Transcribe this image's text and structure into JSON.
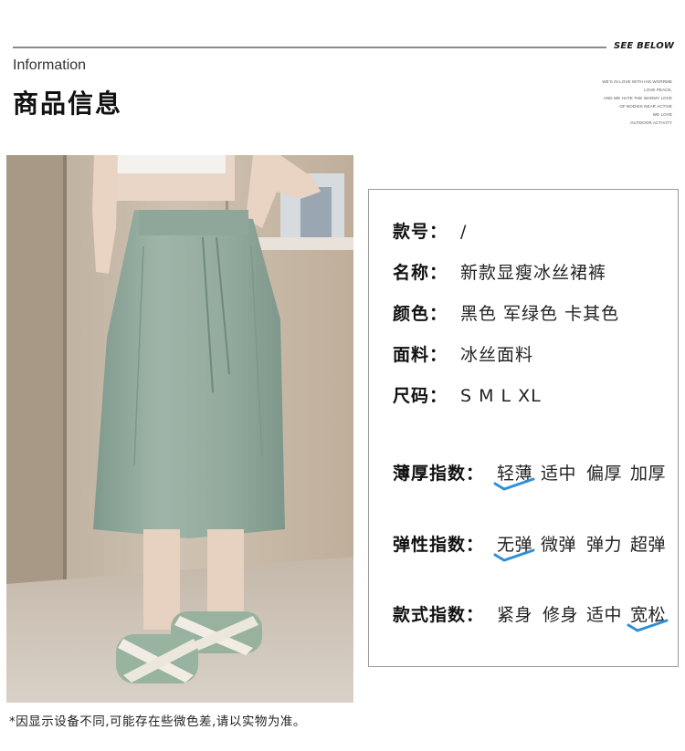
{
  "header": {
    "see_below": "SEE BELOW",
    "tagline": [
      "WE'S IN LOVE WITH HIS WORRME",
      "LOVE PEACE,",
      "AND WE HATE THE WARMY LOVE",
      "OF BODIES NEAR ACTIVE",
      "WE LOVE",
      "OUTDOOR ACTIVITY"
    ],
    "section_en": "Information",
    "section_cn": "商品信息"
  },
  "photo": {
    "description": "product-photo"
  },
  "specs": [
    {
      "key": "款号：",
      "value": "/"
    },
    {
      "key": "名称：",
      "value": "新款显瘦冰丝裙裤"
    },
    {
      "key": "颜色：",
      "value": "黑色 军绿色 卡其色"
    },
    {
      "key": "面料：",
      "value": "冰丝面料"
    },
    {
      "key": "尺码：",
      "value": "S M L XL"
    }
  ],
  "scales": [
    {
      "key": "薄厚指数：",
      "options": [
        "轻薄",
        "适中",
        "偏厚",
        "加厚"
      ],
      "selected": 0
    },
    {
      "key": "弹性指数：",
      "options": [
        "无弹",
        "微弹",
        "弹力",
        "超弹"
      ],
      "selected": 0
    },
    {
      "key": "款式指数：",
      "options": [
        "紧身",
        "修身",
        "适中",
        "宽松"
      ],
      "selected": 3
    }
  ],
  "check_color": "#2f8fd6",
  "disclaimer": "*因显示设备不同,可能存在些微色差,请以实物为准。"
}
